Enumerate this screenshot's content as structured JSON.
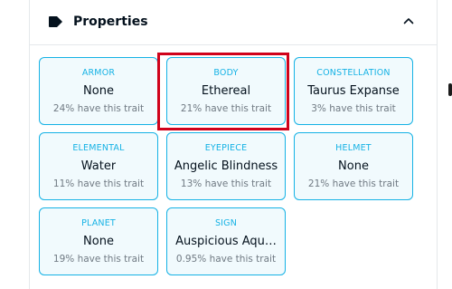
{
  "properties": {
    "title": "Properties",
    "icon": "tag-icon",
    "toggle_icon": "chevron-up-icon",
    "traits": [
      {
        "type": "ARMOR",
        "value": "None",
        "rarity": "24% have this trait"
      },
      {
        "type": "BODY",
        "value": "Ethereal",
        "rarity": "21% have this trait"
      },
      {
        "type": "CONSTELLATION",
        "value": "Taurus Expanse",
        "rarity": "3% have this trait"
      },
      {
        "type": "ELEMENTAL",
        "value": "Water",
        "rarity": "11% have this trait"
      },
      {
        "type": "EYEPIECE",
        "value": "Angelic Blindness",
        "rarity": "13% have this trait"
      },
      {
        "type": "HELMET",
        "value": "None",
        "rarity": "21% have this trait"
      },
      {
        "type": "PLANET",
        "value": "None",
        "rarity": "19% have this trait"
      },
      {
        "type": "SIGN",
        "value": "Auspicious Aqu…",
        "rarity": "0.95% have this trait"
      }
    ]
  },
  "colors": {
    "accent": "#15b2e5",
    "highlight": "#d0021b",
    "text": "#04111d",
    "muted": "#707a83"
  }
}
